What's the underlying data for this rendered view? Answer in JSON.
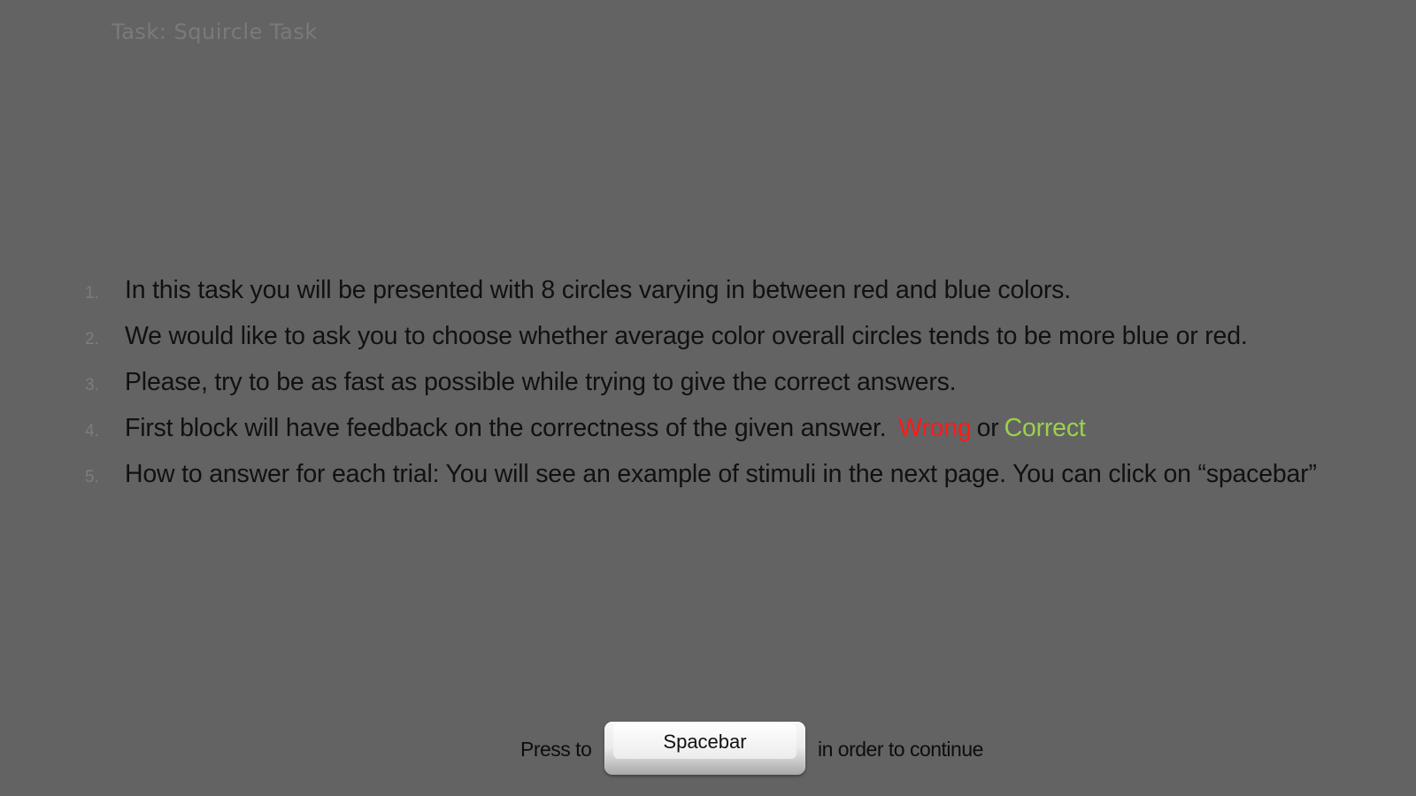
{
  "task_title": "Task: Squircle Task",
  "instructions": [
    {
      "num": "1.",
      "text": "In this task you will be presented with 8 circles varying in between red and blue colors."
    },
    {
      "num": "2.",
      "text": "We would like to ask you to choose whether average color overall circles tends to be more blue or red."
    },
    {
      "num": "3.",
      "text": "Please, try to be as fast as possible while trying to give the correct answers."
    },
    {
      "num": "4.",
      "text": "First block will have feedback on the correctness of the given answer.",
      "wrong": "Wrong",
      "or": "or",
      "correct": "Correct"
    },
    {
      "num": "5.",
      "text": "How to answer for each trial: You will see an example of stimuli in the next page. You can click on “spacebar”"
    }
  ],
  "footer": {
    "press_label": "Press to",
    "key_label": "Spacebar",
    "continue_label": "in order to continue"
  },
  "colors": {
    "background": "#636363",
    "wrong": "#ff1a1a",
    "correct": "#9ad14b"
  }
}
